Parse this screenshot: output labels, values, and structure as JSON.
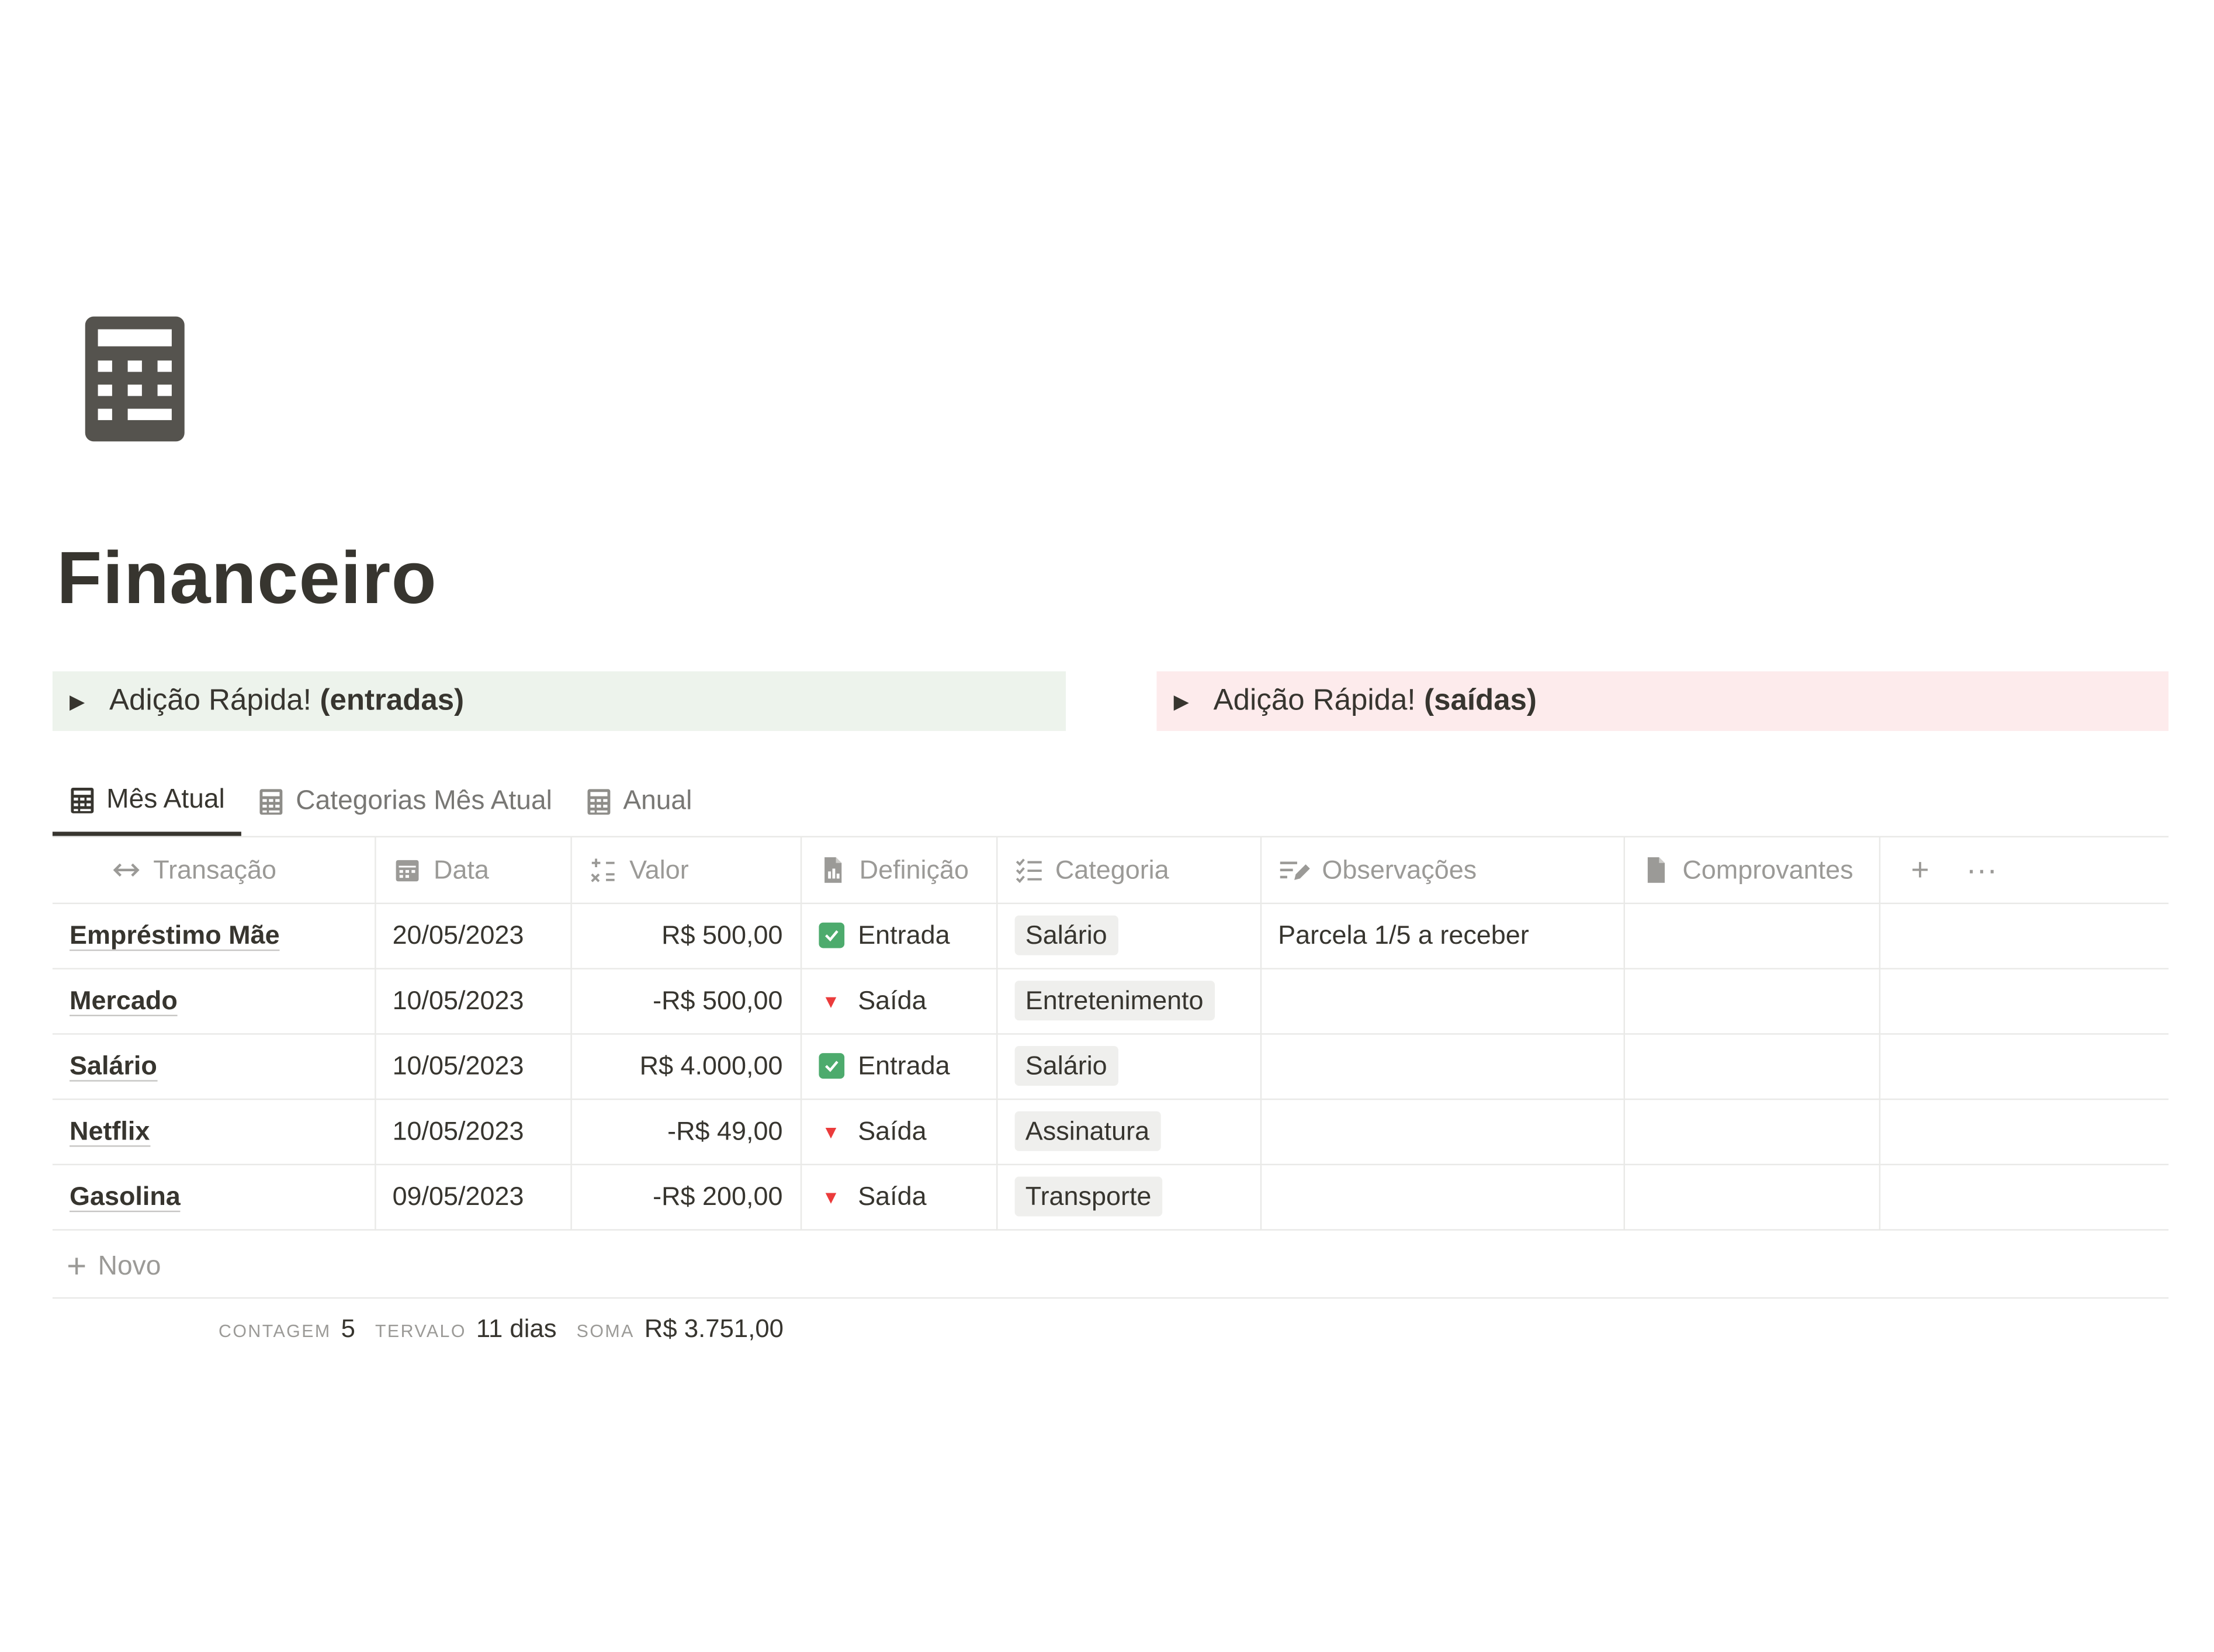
{
  "page": {
    "icon": "calculator-icon",
    "title": "Financeiro"
  },
  "toggles": [
    {
      "prefix": "Adição Rápida!",
      "bold": "(entradas)",
      "color": "#edf3ec"
    },
    {
      "prefix": "Adição Rápida!",
      "bold": "(saídas)",
      "color": "#fdebec"
    }
  ],
  "tabs": [
    {
      "label": "Mês Atual",
      "icon": "table-icon",
      "active": true
    },
    {
      "label": "Categorias Mês Atual",
      "icon": "table-icon",
      "active": false
    },
    {
      "label": "Anual",
      "icon": "table-icon",
      "active": false
    }
  ],
  "columns": [
    {
      "label": "Transação",
      "icon": "arrows-horizontal-icon"
    },
    {
      "label": "Data",
      "icon": "calendar-icon"
    },
    {
      "label": "Valor",
      "icon": "formula-icon"
    },
    {
      "label": "Definição",
      "icon": "document-icon"
    },
    {
      "label": "Categoria",
      "icon": "checklist-icon"
    },
    {
      "label": "Observações",
      "icon": "edit-lines-icon"
    },
    {
      "label": "Comprovantes",
      "icon": "file-icon"
    }
  ],
  "rows": [
    {
      "name": "Empréstimo Mãe",
      "date": "20/05/2023",
      "value": "R$ 500,00",
      "definition": "Entrada",
      "category": "Salário",
      "notes": "Parcela 1/5 a receber"
    },
    {
      "name": "Mercado",
      "date": "10/05/2023",
      "value": "-R$ 500,00",
      "definition": "Saída",
      "category": "Entretenimento",
      "notes": ""
    },
    {
      "name": "Salário",
      "date": "10/05/2023",
      "value": "R$ 4.000,00",
      "definition": "Entrada",
      "category": "Salário",
      "notes": ""
    },
    {
      "name": "Netflix",
      "date": "10/05/2023",
      "value": "-R$ 49,00",
      "definition": "Saída",
      "category": "Assinatura",
      "notes": ""
    },
    {
      "name": "Gasolina",
      "date": "09/05/2023",
      "value": "-R$ 200,00",
      "definition": "Saída",
      "category": "Transporte",
      "notes": ""
    }
  ],
  "table_actions": {
    "add": "+",
    "more": "···"
  },
  "new_row": {
    "label": "Novo"
  },
  "summary": {
    "count_label": "CONTAGEM",
    "count_value": "5",
    "range_label": "TERVALO",
    "range_value": "11 dias",
    "sum_label": "SOMA",
    "sum_value": "R$ 3.751,00"
  },
  "colors": {
    "entrada": "#4dab6d",
    "saida": "#eb3b3b",
    "tag_bg": "#efefed"
  }
}
